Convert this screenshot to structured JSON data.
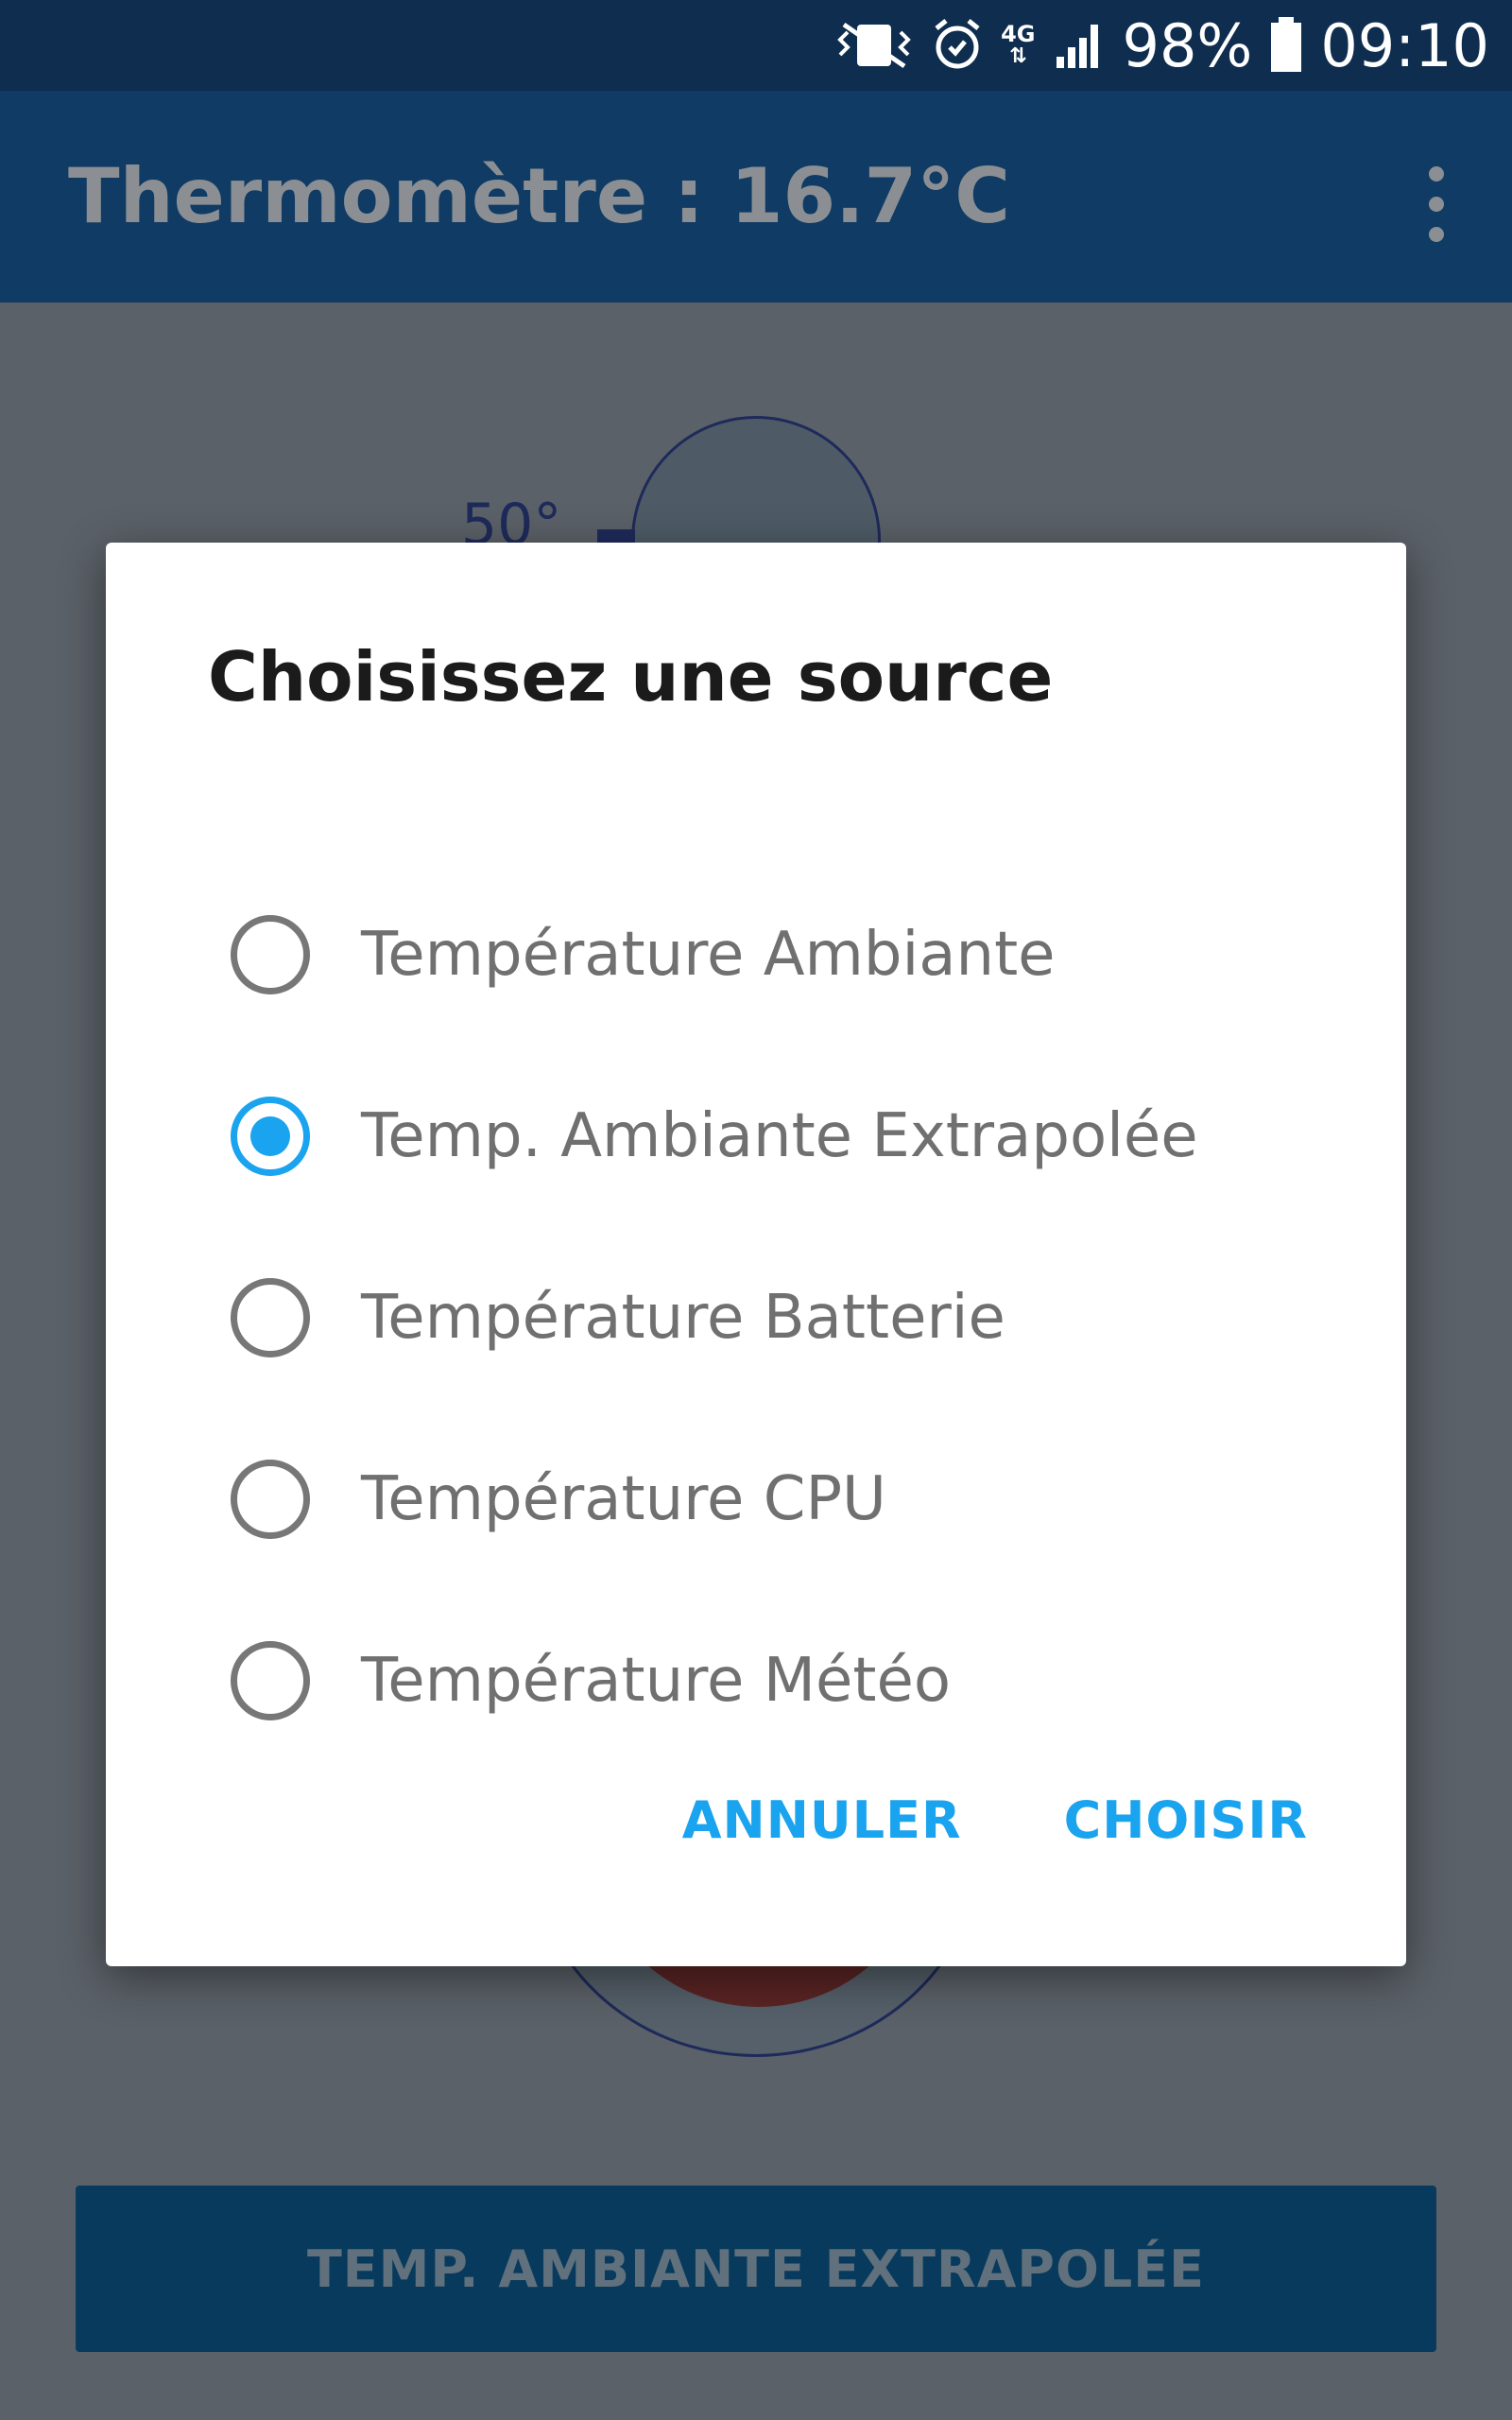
{
  "status_bar": {
    "battery": "98%",
    "time": "09:10",
    "icons": [
      "mute-vibrate-icon",
      "alarm-icon",
      "network-4g-icon",
      "signal-icon",
      "battery-icon"
    ],
    "network_label": "4G"
  },
  "app_bar": {
    "title": "Thermomètre : 16.7°C",
    "menu_icon": "more-vert-icon"
  },
  "thermometer": {
    "scale_label": "50°"
  },
  "dialog": {
    "title": "Choisissez une source",
    "options": [
      {
        "label": "Température Ambiante",
        "selected": false
      },
      {
        "label": "Temp. Ambiante Extrapolée",
        "selected": true
      },
      {
        "label": "Température Batterie",
        "selected": false
      },
      {
        "label": "Température CPU",
        "selected": false
      },
      {
        "label": "Température Météo",
        "selected": false
      }
    ],
    "cancel_label": "ANNULER",
    "confirm_label": "CHOISIR"
  },
  "source_button_label": "TEMP. AMBIANTE EXTRAPOLÉE",
  "colors": {
    "accent": "#1aa3ee",
    "app_bar": "#0f3b64",
    "status_bar": "#0f2d4e",
    "scrim": "#5b6168"
  }
}
